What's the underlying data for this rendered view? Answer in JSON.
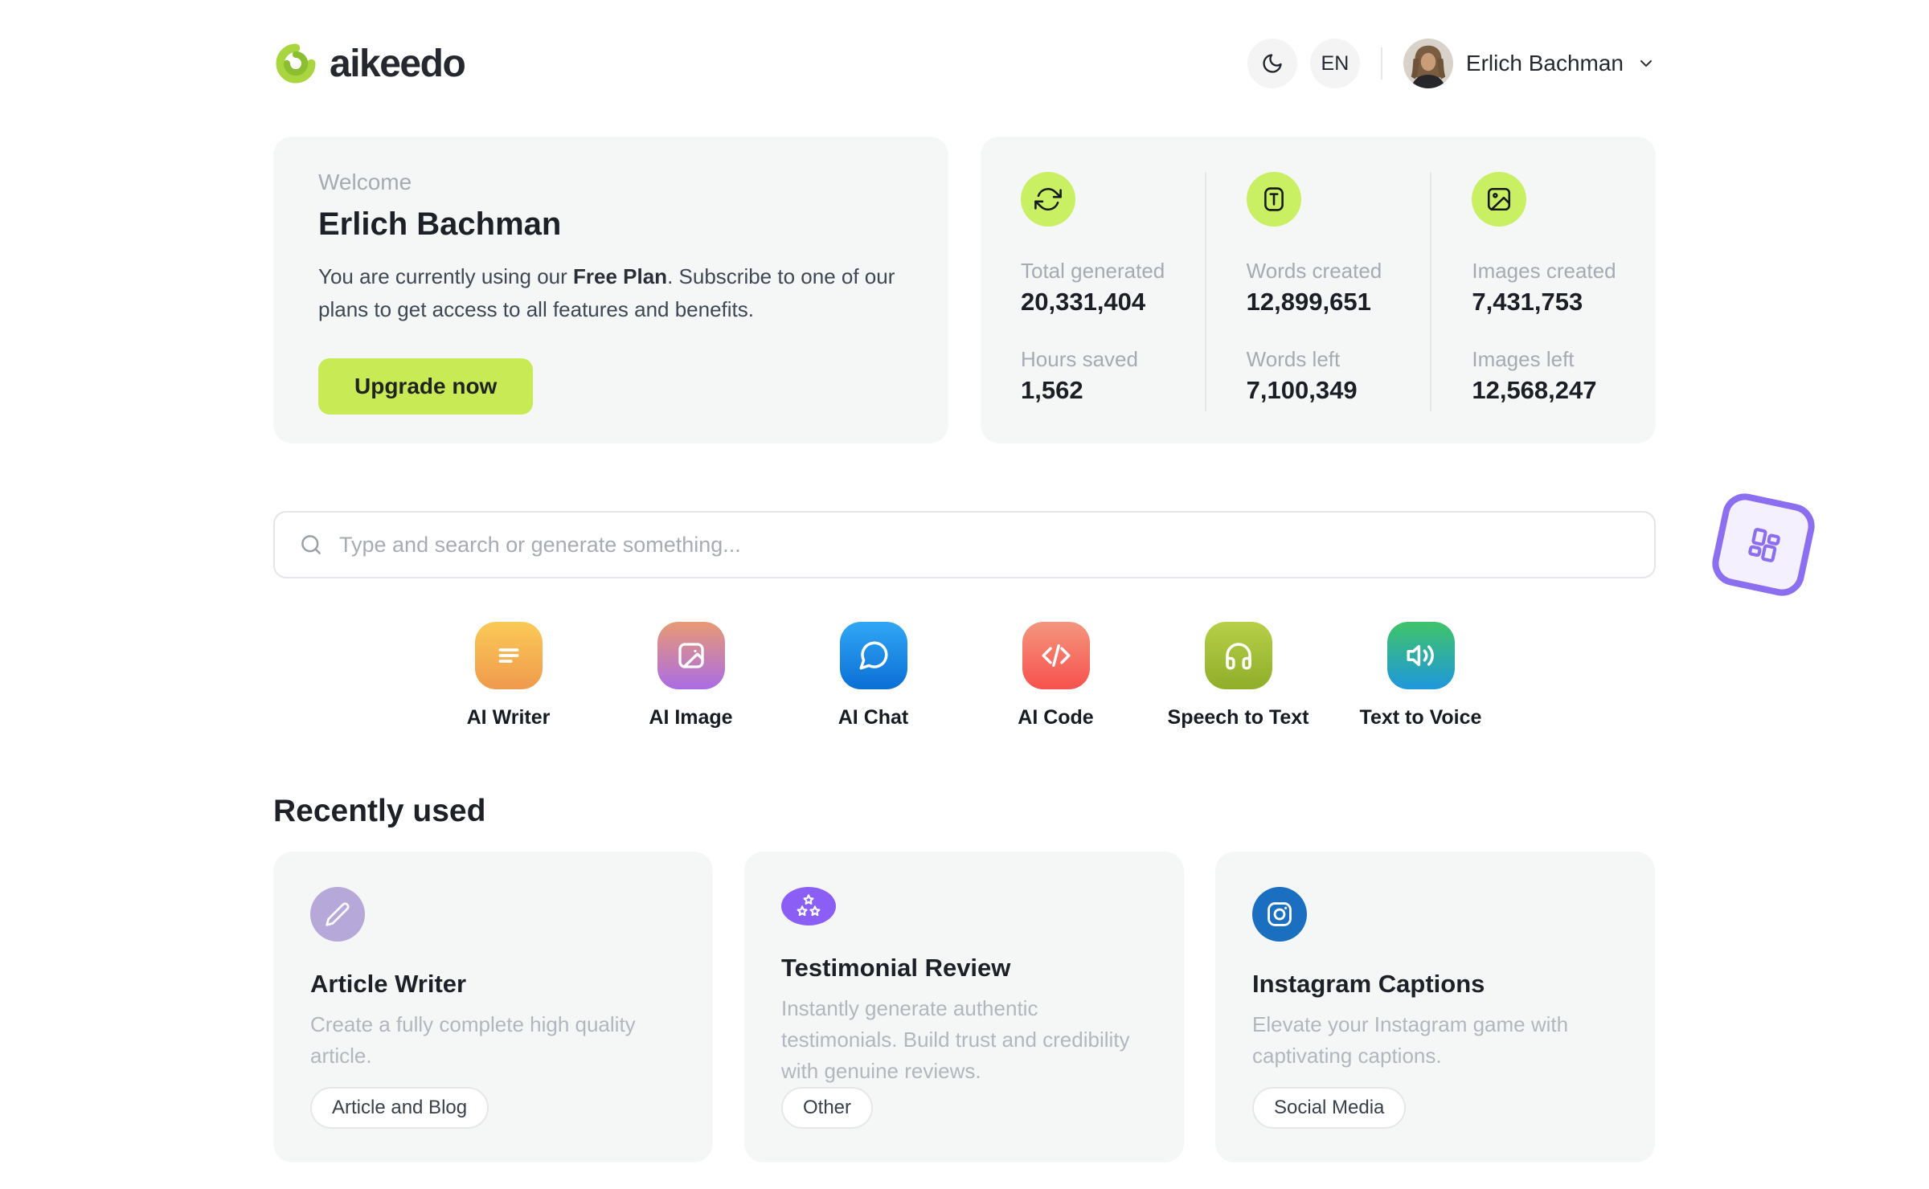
{
  "brand": {
    "name": "aikeedo"
  },
  "header": {
    "locale": "EN",
    "user_name": "Erlich Bachman"
  },
  "welcome": {
    "eyebrow": "Welcome",
    "name": "Erlich Bachman",
    "body_prefix": "You are currently using our ",
    "plan": "Free Plan",
    "body_suffix": ". Subscribe to one of our plans to get access to all features and benefits.",
    "cta": "Upgrade now"
  },
  "stats": {
    "columns": [
      {
        "icon": "refresh-icon",
        "rows": [
          {
            "label": "Total generated",
            "value": "20,331,404"
          },
          {
            "label": "Hours saved",
            "value": "1,562"
          }
        ]
      },
      {
        "icon": "text-icon",
        "rows": [
          {
            "label": "Words created",
            "value": "12,899,651"
          },
          {
            "label": "Words left",
            "value": "7,100,349"
          }
        ]
      },
      {
        "icon": "image-icon",
        "rows": [
          {
            "label": "Images created",
            "value": "7,431,753"
          },
          {
            "label": "Images left",
            "value": "12,568,247"
          }
        ]
      }
    ]
  },
  "search": {
    "placeholder": "Type and search or generate something..."
  },
  "tools": [
    {
      "label": "AI Writer",
      "icon": "writer-icon"
    },
    {
      "label": "AI Image",
      "icon": "image-icon"
    },
    {
      "label": "AI Chat",
      "icon": "chat-icon"
    },
    {
      "label": "AI Code",
      "icon": "code-icon"
    },
    {
      "label": "Speech to Text",
      "icon": "headphones-icon"
    },
    {
      "label": "Text to Voice",
      "icon": "speaker-icon"
    }
  ],
  "recently_used": {
    "title": "Recently used",
    "cards": [
      {
        "title": "Article Writer",
        "description": "Create a fully complete high quality article.",
        "tag": "Article and Blog",
        "icon": "pencil-icon",
        "icon_bg": "#b7a8da"
      },
      {
        "title": "Testimonial Review",
        "description": "Instantly generate authentic testimonials. Build trust and credibility with genuine reviews.",
        "tag": "Other",
        "icon": "stars-icon",
        "icon_bg": "#8b5ef6"
      },
      {
        "title": "Instagram Captions",
        "description": "Elevate your Instagram game with captivating captions.",
        "tag": "Social Media",
        "icon": "instagram-icon",
        "icon_bg": "#1b6fc0"
      }
    ]
  },
  "colors": {
    "brand_lime": "#c8eb55",
    "stat_circle_lime": "#c9ef62",
    "writer_gradient": [
      "#fbca57",
      "#ef9a4d"
    ],
    "image_gradient": [
      "#e89a73",
      "#aa6ce6"
    ],
    "chat_gradient": [
      "#31a7f6",
      "#0a6fd4"
    ],
    "code_gradient": [
      "#f4967e",
      "#f7514d"
    ],
    "speech_gradient": [
      "#b8cf48",
      "#8fae2a"
    ],
    "voice_gradient": [
      "#3fc468",
      "#1f97dd"
    ],
    "sticker_purple": "#8b6ff0",
    "card_bg": "#f5f6f6"
  }
}
